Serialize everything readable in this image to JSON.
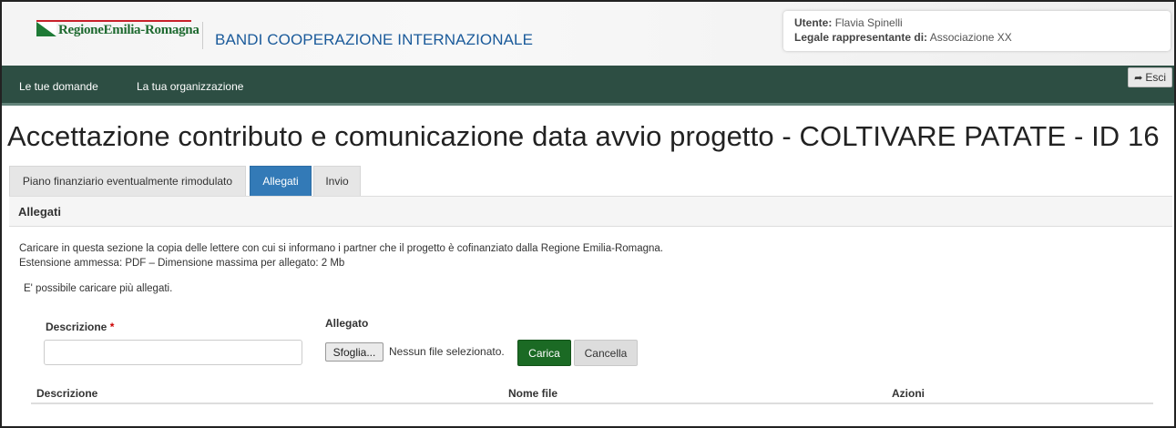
{
  "header": {
    "logo_text": "RegioneEmilia-Romagna",
    "app_title": "BANDI COOPERAZIONE INTERNAZIONALE",
    "user_label": "Utente:",
    "user_name": "Flavia Spinelli",
    "legal_label": "Legale rappresentante di:",
    "legal_value": "Associazione XX"
  },
  "nav": {
    "items": [
      "Le tue domande",
      "La tua organizzazione"
    ],
    "exit_label": "Esci",
    "exit_icon": "sign-out-icon"
  },
  "page": {
    "title": "Accettazione contributo e comunicazione data avvio progetto - COLTIVARE PATATE - ID 16"
  },
  "tabs": [
    {
      "label": "Piano finanziario eventualmente rimodulato",
      "active": false
    },
    {
      "label": "Allegati",
      "active": true
    },
    {
      "label": "Invio",
      "active": false
    }
  ],
  "section": {
    "title": "Allegati",
    "description_line1": "Caricare in questa sezione la copia delle lettere con cui si informano i partner che il progetto è cofinanziato dalla Regione Emilia-Romagna.",
    "description_line2": "Estensione ammessa: PDF – Dimensione massima per allegato: 2 Mb",
    "note": "E' possibile caricare più allegati."
  },
  "form": {
    "description_label": "Descrizione",
    "required_mark": "*",
    "description_value": "",
    "attachment_label": "Allegato",
    "browse_label": "Sfoglia...",
    "no_file_text": "Nessun file selezionato.",
    "upload_label": "Carica",
    "cancel_label": "Cancella"
  },
  "table": {
    "columns": [
      "Descrizione",
      "Nome file",
      "Azioni"
    ]
  },
  "colors": {
    "nav_bg": "#2d4e43",
    "active_tab": "#337ab7",
    "upload_button": "#1b6a24",
    "title_blue": "#1a5a9a"
  }
}
